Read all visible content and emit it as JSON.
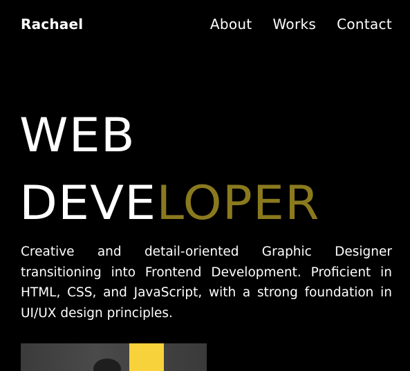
{
  "header": {
    "brand": "Rachael",
    "nav": [
      "About",
      "Works",
      "Contact"
    ]
  },
  "hero": {
    "line1": "WEB",
    "line2_white": "DEVE",
    "line2_accent": "LOPER"
  },
  "intro": {
    "text": "Creative and detail-oriented Graphic Designer transitioning into Frontend Development. Proficient in HTML, CSS, and JavaScript, with a strong foundation in UI/UX design principles."
  },
  "colors": {
    "background": "#000000",
    "text": "#ffffff",
    "accent": "#8a7a1e",
    "image_yellow": "#f7d23a"
  }
}
